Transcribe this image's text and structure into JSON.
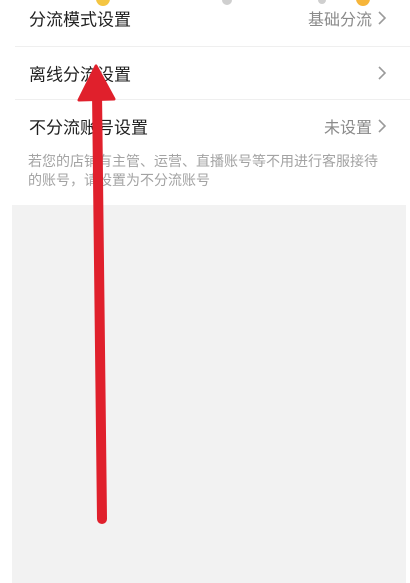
{
  "settings": {
    "rows": [
      {
        "label": "分流模式设置",
        "value": "基础分流"
      },
      {
        "label": "离线分流设置",
        "value": ""
      },
      {
        "label": "不分流账号设置",
        "value": "未设置"
      }
    ],
    "hint": "若您的店铺有主管、运营、直播账号等不用进行客服接待的账号，请设置为不分流账号"
  },
  "annotation": {
    "arrow_color": "#e0202c"
  },
  "colors": {
    "background": "#ffffff",
    "gray_area": "#f2f2f2",
    "hint_text": "#a3a3a3",
    "value_text": "#8a8a8a"
  }
}
